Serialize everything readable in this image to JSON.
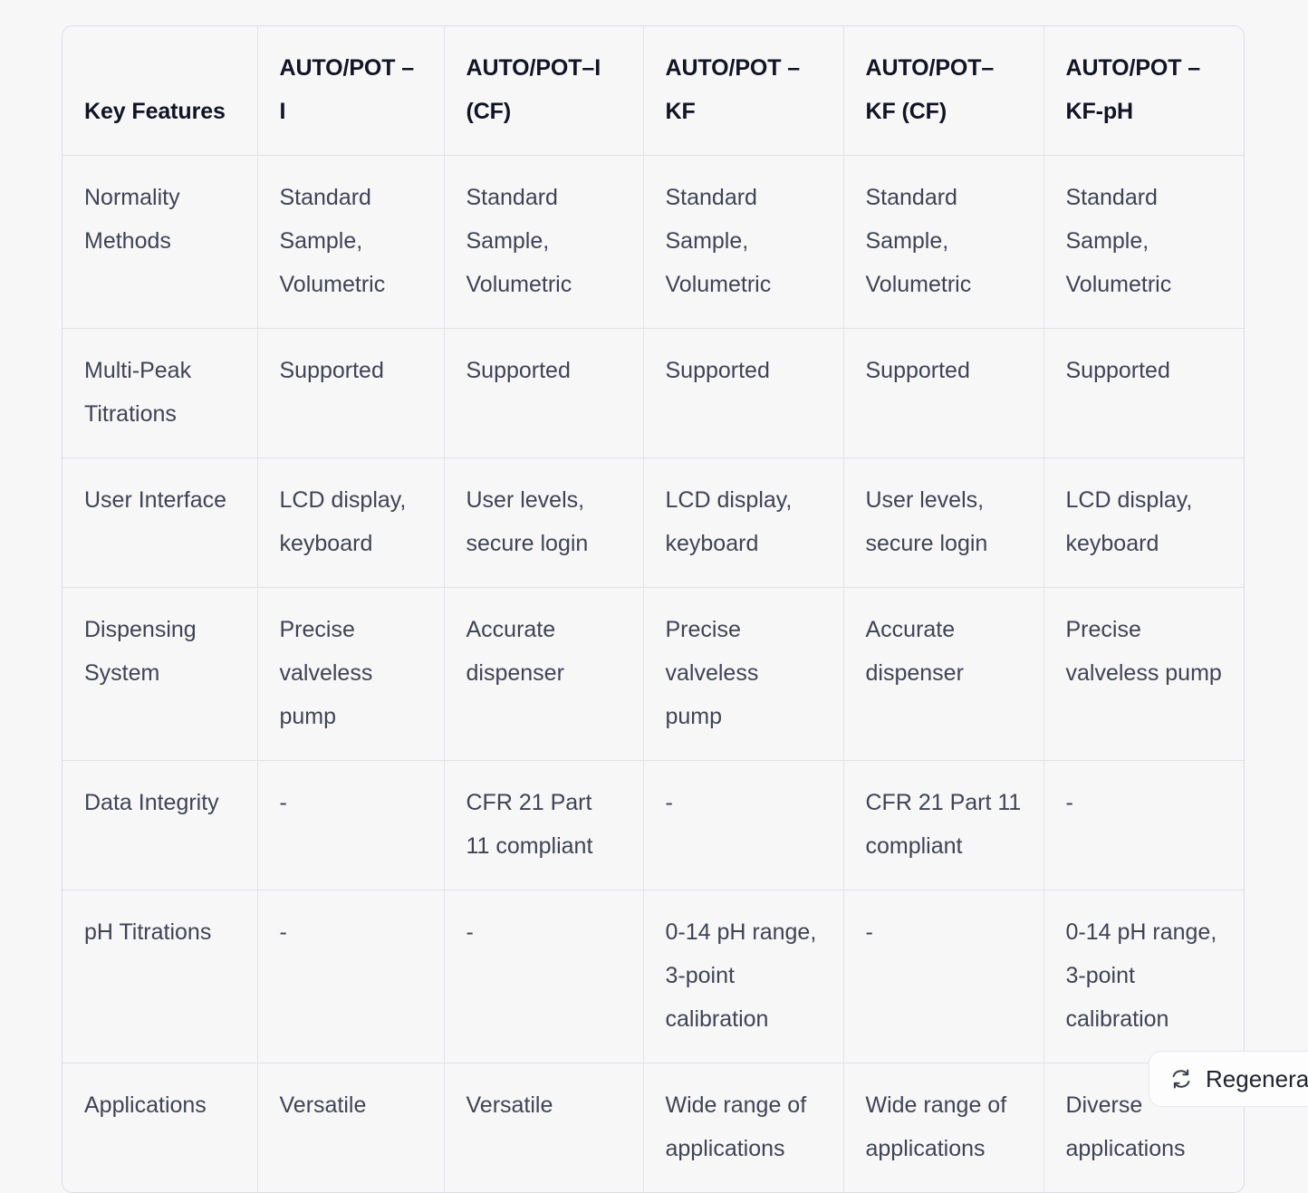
{
  "table": {
    "columns": [
      "Key Features",
      "AUTO/POT – I",
      "AUTO/POT–I (CF)",
      "AUTO/POT – KF",
      "AUTO/POT– KF (CF)",
      "AUTO/POT – KF-pH"
    ],
    "columns_display": [
      "Key Features",
      "AUTO/POT\n– I",
      "AUTO/POT–I\n(CF)",
      "AUTO/POT –\nKF",
      "AUTO/POT–\nKF (CF)",
      "AUTO/POT –\nKF-pH"
    ],
    "rows": [
      {
        "feature": "Normality Methods",
        "values": [
          "Standard Sample, Volumetric",
          "Standard Sample, Volumetric",
          "Standard Sample, Volumetric",
          "Standard Sample, Volumetric",
          "Standard Sample, Volumetric"
        ]
      },
      {
        "feature": "Multi-Peak Titrations",
        "values": [
          "Supported",
          "Supported",
          "Supported",
          "Supported",
          "Supported"
        ]
      },
      {
        "feature": "User Interface",
        "values": [
          "LCD display, keyboard",
          "User levels, secure login",
          "LCD display, keyboard",
          "User levels, secure login",
          "LCD display, keyboard"
        ]
      },
      {
        "feature": "Dispensing System",
        "values": [
          "Precise valveless pump",
          "Accurate dispenser",
          "Precise valveless pump",
          "Accurate dispenser",
          "Precise valveless pump"
        ]
      },
      {
        "feature": "Data Integrity",
        "values": [
          "-",
          "CFR 21 Part 11 compliant",
          "-",
          "CFR 21 Part 11 compliant",
          "-"
        ]
      },
      {
        "feature": "pH Titrations",
        "values": [
          "-",
          "-",
          "0-14 pH range, 3-point calibration",
          "-",
          "0-14 pH range, 3-point calibration"
        ]
      },
      {
        "feature": "Applications",
        "values": [
          "Versatile",
          "Versatile",
          "Wide range of applications",
          "Wide range of applications",
          "Diverse applications"
        ]
      }
    ]
  },
  "regenerate": {
    "label": "Regenerate",
    "icon": "regenerate-icon"
  },
  "colors": {
    "page_background": "#f7f7f8",
    "table_background": "#f7f7f8",
    "table_border": "#dcdce6",
    "cell_border": "#e0e0ec",
    "header_text": "#101424",
    "body_text": "#3f4455",
    "button_background": "#fdfdfd",
    "button_border": "#e6e6ee"
  }
}
